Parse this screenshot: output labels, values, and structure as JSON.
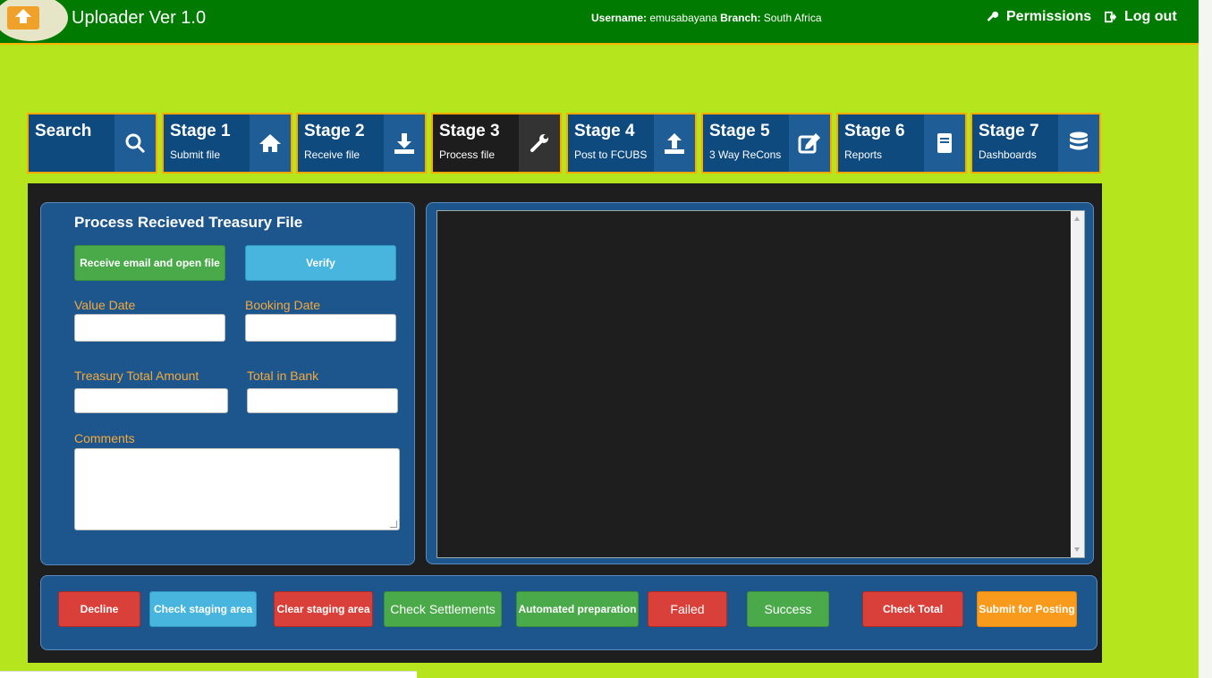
{
  "header": {
    "app_title": "Uploader Ver 1.0",
    "username_label": "Username:",
    "username": "emusabayana",
    "branch_label": "Branch:",
    "branch": "South Africa",
    "permissions": "Permissions",
    "logout": "Log out"
  },
  "tabs": [
    {
      "title": "Search",
      "subtitle": "",
      "icon": "search-icon"
    },
    {
      "title": "Stage 1",
      "subtitle": "Submit file",
      "icon": "home-icon"
    },
    {
      "title": "Stage 2",
      "subtitle": "Receive file",
      "icon": "download-icon"
    },
    {
      "title": "Stage 3",
      "subtitle": "Process file",
      "icon": "wrench-icon",
      "active": true
    },
    {
      "title": "Stage 4",
      "subtitle": "Post to FCUBS",
      "icon": "upload-icon"
    },
    {
      "title": "Stage 5",
      "subtitle": "3 Way ReCons",
      "icon": "edit-icon"
    },
    {
      "title": "Stage 6",
      "subtitle": "Reports",
      "icon": "book-icon"
    },
    {
      "title": "Stage 7",
      "subtitle": "Dashboards",
      "icon": "database-icon"
    }
  ],
  "form": {
    "title": "Process Recieved Treasury File",
    "receive_btn": "Receive email and open file",
    "verify_btn": "Verify",
    "value_date_label": "Value Date",
    "booking_date_label": "Booking Date",
    "treasury_total_label": "Treasury Total Amount",
    "total_in_bank_label": "Total in Bank",
    "comments_label": "Comments"
  },
  "actions": {
    "decline": "Decline",
    "check_staging": "Check staging area",
    "clear_staging": "Clear staging area",
    "check_settlements": "Check Settlements",
    "automated_prep": "Automated preparation",
    "failed": "Failed",
    "success": "Success",
    "check_total": "Check Total",
    "submit_posting": "Submit for Posting"
  },
  "colors": {
    "background": "#b5e61d",
    "header": "#007a00",
    "tab": "#0e4a7e",
    "tab_border": "#ffa800",
    "panel": "#1c568c",
    "label": "#f6a93b"
  }
}
